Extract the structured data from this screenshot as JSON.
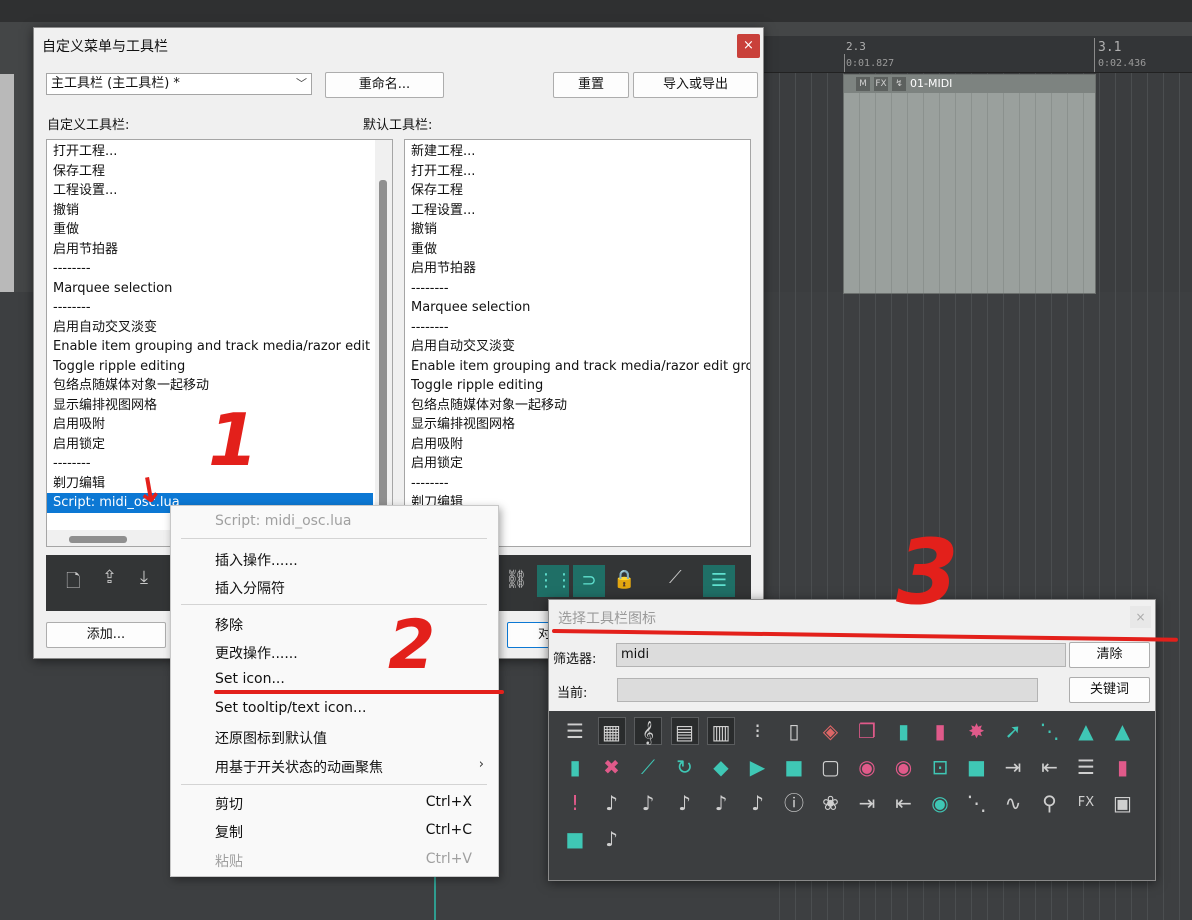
{
  "daw": {
    "ruler": {
      "mark1": "2.3",
      "time1": "0:01.827",
      "mark2": "3.1",
      "time2": "0:02.436"
    },
    "midi_item": {
      "name": "01-MIDI",
      "buttons": [
        "M",
        "FX",
        "↯"
      ]
    },
    "accent": "#2f9c8f"
  },
  "main_dialog": {
    "title": "自定义菜单与工具栏",
    "close_label": "×",
    "toolbar_select_value": "主工具栏 (主工具栏) *",
    "rename_label": "重命名...",
    "reset_label": "重置",
    "import_export_label": "导入或导出",
    "custom_toolbar_label": "自定义工具栏:",
    "default_toolbar_label": "默认工具栏:",
    "custom_items": [
      "打开工程...",
      "保存工程",
      "工程设置...",
      "撤销",
      "重做",
      "启用节拍器",
      "--------",
      "Marquee selection",
      "--------",
      "启用自动交叉淡变",
      "Enable item grouping and track media/razor edit grouping",
      "Toggle ripple editing",
      "包络点随媒体对象一起移动",
      "显示编排视图网格",
      "启用吸附",
      "启用锁定",
      "--------",
      "剃刀编辑",
      "Script: midi_osc.lua"
    ],
    "default_items": [
      "新建工程...",
      "打开工程...",
      "保存工程",
      "工程设置...",
      "撤销",
      "重做",
      "启用节拍器",
      "--------",
      "Marquee selection",
      "--------",
      "启用自动交叉淡变",
      "Enable item grouping and track media/razor edit grouping",
      "Toggle ripple editing",
      "包络点随媒体对象一起移动",
      "显示编排视图网格",
      "启用吸附",
      "启用锁定",
      "--------",
      "剃刀编辑"
    ],
    "add_label": "添加...",
    "partial_button_label": "对"
  },
  "context_menu": {
    "header": "Script: midi_osc.lua",
    "items": {
      "insert_action": "插入操作......",
      "insert_separator": "插入分隔符",
      "remove": "移除",
      "change_action": "更改操作......",
      "set_icon": "Set icon...",
      "set_tooltip": "Set tooltip/text icon...",
      "restore_icon": "还原图标到默认值",
      "animate_focus": "用基于开关状态的动画聚焦",
      "cut": "剪切",
      "copy": "复制",
      "paste": "粘贴"
    },
    "shortcuts": {
      "cut": "Ctrl+X",
      "copy": "Ctrl+C",
      "paste": "Ctrl+V"
    }
  },
  "icon_dialog": {
    "title": "选择工具栏图标",
    "close_label": "×",
    "filter_label": "筛选器:",
    "filter_value": "midi",
    "clear_label": "清除",
    "current_label": "当前:",
    "current_value": "",
    "keyword_label": "关键词"
  },
  "annotations": {
    "one": "1",
    "two": "2",
    "three": "3"
  }
}
